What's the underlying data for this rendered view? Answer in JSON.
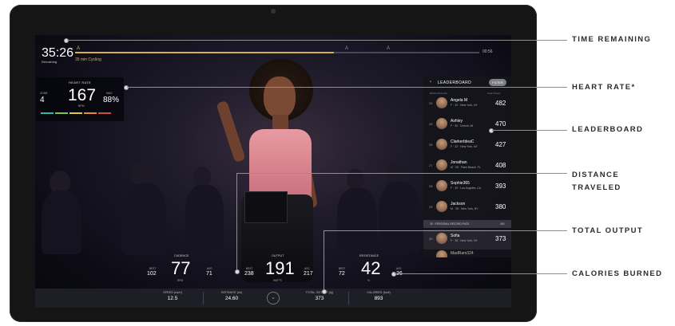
{
  "top_bar": {
    "time_remaining": "35:26",
    "time_label": "Remaining",
    "class_title": "35 min Cycling",
    "segment_marks": [
      "A",
      "A",
      "A"
    ],
    "end_time": "00:56",
    "progress_fraction": 0.64
  },
  "heart_rate": {
    "title": "HEART RATE",
    "zone_label": "ZONE",
    "zone": "4",
    "value": "167",
    "unit": "BPM",
    "max_label": "MAX",
    "percent": "88%",
    "zone_colors": [
      "#2fb8a4",
      "#7cc653",
      "#e3c34a",
      "#e88a3a",
      "#d24b4b"
    ]
  },
  "leaderboard": {
    "title": "LEADERBOARD",
    "button": "FILTER",
    "sub_left": "#5124 Workouts",
    "sub_right": "Total Output",
    "rows": [
      {
        "rank": "25",
        "name": "Angela M",
        "loc": "F · 32 · New York, NY",
        "score": "482"
      },
      {
        "rank": "26",
        "name": "Ashley",
        "loc": "F · 30 · Detroit, MI",
        "score": "470"
      },
      {
        "rank": "28",
        "name": "ClarkerIdeaC",
        "loc": "F · 32 · New York, NY",
        "score": "427"
      },
      {
        "rank": "27",
        "name": "Jonathan",
        "loc": "M · 25 · Palm Beach, FL",
        "score": "408"
      },
      {
        "rank": "28",
        "name": "Sophie365",
        "loc": "F · 30 · Los Angeles, CA",
        "score": "393"
      },
      {
        "rank": "29",
        "name": "Jackson",
        "loc": "M · 28 · New York, NY",
        "score": "380"
      }
    ],
    "divider_text": "30 · PERSONAL RECORD PACE",
    "divider_num": "400",
    "self_row": {
      "rank": "30",
      "name": "Sofia",
      "loc": "F · 28 · New York, NY",
      "score": "373"
    },
    "peek_row": {
      "name": "MadRam324"
    }
  },
  "metrics": {
    "cadence": {
      "label": "CADENCE",
      "best_label": "BEST",
      "best": "102",
      "value": "77",
      "unit": "RPM",
      "avg_label": "AVG",
      "avg": "71"
    },
    "output": {
      "label": "OUTPUT",
      "best_label": "BEST",
      "best": "238",
      "value": "191",
      "unit": "WATTS",
      "avg_label": "AVG",
      "avg": "217"
    },
    "resistance": {
      "label": "RESISTANCE",
      "best_label": "BEST",
      "best": "72",
      "value": "42",
      "unit": "%",
      "avg_label": "AVG",
      "avg": "36"
    }
  },
  "bottom_bar": {
    "speed_label": "SPEED (mph)",
    "speed": "12.5",
    "distance_label": "DISTANCE (mi)",
    "distance": "24.60",
    "total_output_label": "TOTAL OUTPUT (kj)",
    "total_output": "373",
    "calories_label": "CALORIES (kcal)",
    "calories": "893"
  },
  "callouts": [
    {
      "key": "time",
      "text": "TIME REMAINING"
    },
    {
      "key": "heart",
      "text": "HEART RATE*"
    },
    {
      "key": "leader",
      "text": "LEADERBOARD"
    },
    {
      "key": "distance",
      "text": "DISTANCE TRAVELED"
    },
    {
      "key": "output",
      "text": "TOTAL OUTPUT"
    },
    {
      "key": "calories",
      "text": "CALORIES BURNED"
    }
  ]
}
